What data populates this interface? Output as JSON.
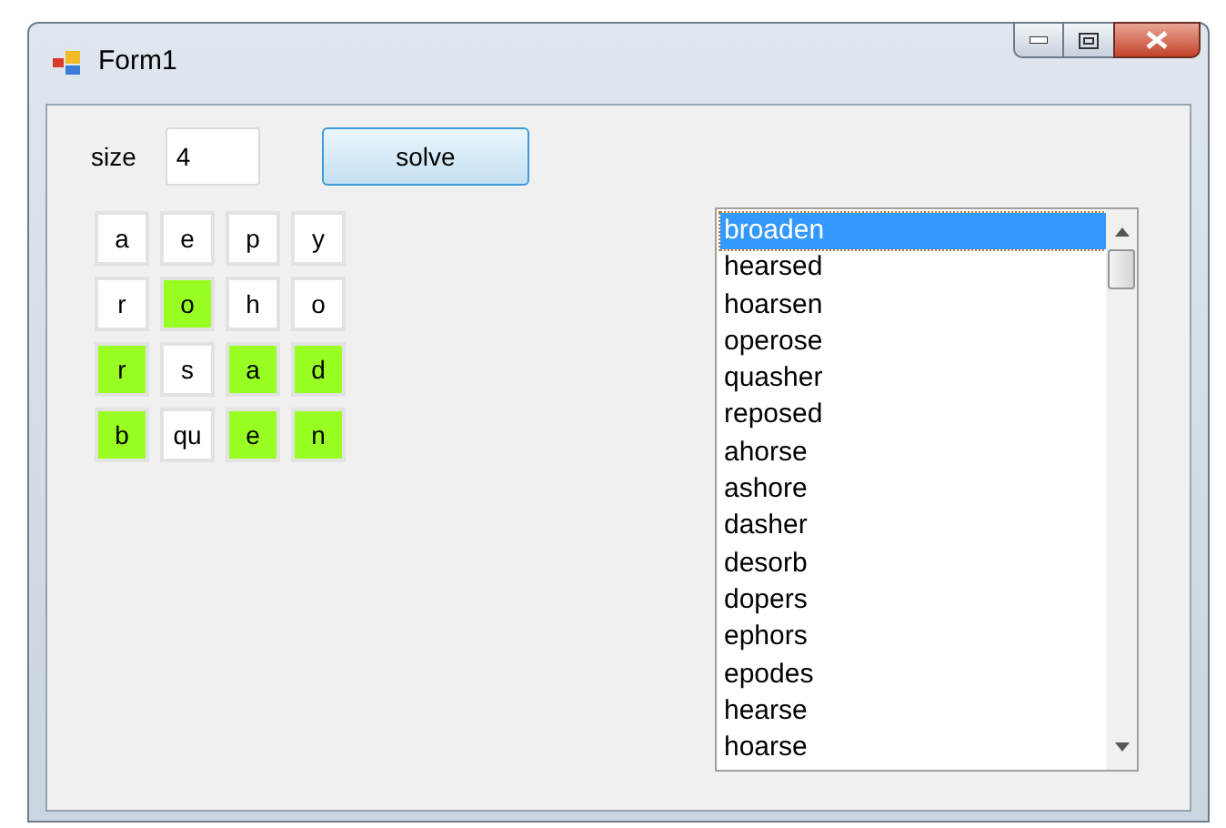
{
  "window": {
    "title": "Form1"
  },
  "size": {
    "label": "size",
    "value": "4"
  },
  "solve_button": "solve",
  "grid": [
    [
      {
        "letter": "a",
        "highlighted": false
      },
      {
        "letter": "e",
        "highlighted": false
      },
      {
        "letter": "p",
        "highlighted": false
      },
      {
        "letter": "y",
        "highlighted": false
      }
    ],
    [
      {
        "letter": "r",
        "highlighted": false
      },
      {
        "letter": "o",
        "highlighted": true
      },
      {
        "letter": "h",
        "highlighted": false
      },
      {
        "letter": "o",
        "highlighted": false
      }
    ],
    [
      {
        "letter": "r",
        "highlighted": true
      },
      {
        "letter": "s",
        "highlighted": false
      },
      {
        "letter": "a",
        "highlighted": true
      },
      {
        "letter": "d",
        "highlighted": true
      }
    ],
    [
      {
        "letter": "b",
        "highlighted": true
      },
      {
        "letter": "qu",
        "highlighted": false
      },
      {
        "letter": "e",
        "highlighted": true
      },
      {
        "letter": "n",
        "highlighted": true
      }
    ]
  ],
  "words": [
    {
      "text": "broaden",
      "selected": true
    },
    {
      "text": "hearsed",
      "selected": false
    },
    {
      "text": "hoarsen",
      "selected": false
    },
    {
      "text": "operose",
      "selected": false
    },
    {
      "text": "quasher",
      "selected": false
    },
    {
      "text": "reposed",
      "selected": false
    },
    {
      "text": "ahorse",
      "selected": false
    },
    {
      "text": "ashore",
      "selected": false
    },
    {
      "text": "dasher",
      "selected": false
    },
    {
      "text": "desorb",
      "selected": false
    },
    {
      "text": "dopers",
      "selected": false
    },
    {
      "text": "ephors",
      "selected": false
    },
    {
      "text": "epodes",
      "selected": false
    },
    {
      "text": "hearse",
      "selected": false
    },
    {
      "text": "hoarse",
      "selected": false
    }
  ]
}
